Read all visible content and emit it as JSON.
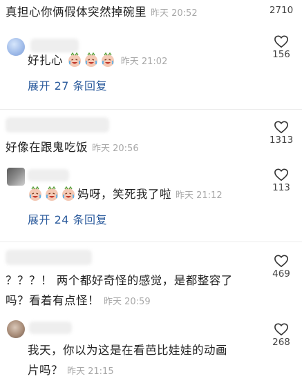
{
  "comments": [
    {
      "text": "真担心你俩假体突然掉碗里",
      "time": "昨天 20:52",
      "likes": "2710"
    },
    {
      "text": "好扎心",
      "time": "昨天 21:02",
      "likes": "156",
      "expand_label": "展开 27 条回复"
    },
    {
      "text": "好像在跟鬼吃饭",
      "time": "昨天 20:56",
      "likes": "1313"
    },
    {
      "text": "妈呀，笑死我了啦",
      "time": "昨天 21:12",
      "likes": "113",
      "expand_label": "展开 24 条回复"
    },
    {
      "text_line1": "？？？！ 两个都好奇怪的感觉，是都整容了",
      "text_line2": "吗？看着有点怪！",
      "time": "昨天 20:59",
      "likes": "469"
    },
    {
      "text_line1": "我天，你以为这是在看芭比娃娃的动画",
      "text_line2": "片吗？",
      "time": "昨天 21:15",
      "likes": "268"
    }
  ],
  "icons": {
    "like": "heart-outline-icon",
    "emoji": "laugh-cry-emoji"
  },
  "colors": {
    "link": "#2a5a9c",
    "meta": "#a8a8a8"
  }
}
